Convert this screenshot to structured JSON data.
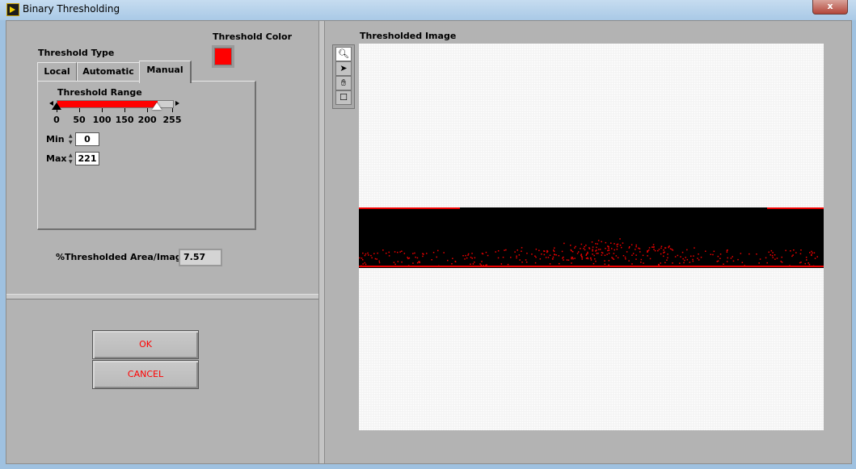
{
  "window": {
    "title": "Binary Thresholding",
    "close_label": "x"
  },
  "left": {
    "threshold_type_label": "Threshold Type",
    "threshold_color_label": "Threshold Color",
    "threshold_color": "#ff0000",
    "tabs": [
      {
        "label": "Local"
      },
      {
        "label": "Automatic"
      },
      {
        "label": "Manual",
        "selected": true
      }
    ],
    "range": {
      "label": "Threshold Range",
      "min": 0,
      "max": 255,
      "low": 0,
      "high": 221,
      "ticks": [
        "0",
        "50",
        "100",
        "150",
        "200",
        "255"
      ]
    },
    "min_label": "Min",
    "min_value": "0",
    "max_label": "Max",
    "max_value": "221",
    "area_label": "%Thresholded Area/Image",
    "area_value": "7.57",
    "ok_label": "OK",
    "cancel_label": "CANCEL"
  },
  "right": {
    "image_label": "Thresholded Image",
    "tools": [
      "zoom-icon",
      "pointer-icon",
      "pan-hand-icon",
      "rectangle-icon"
    ]
  }
}
